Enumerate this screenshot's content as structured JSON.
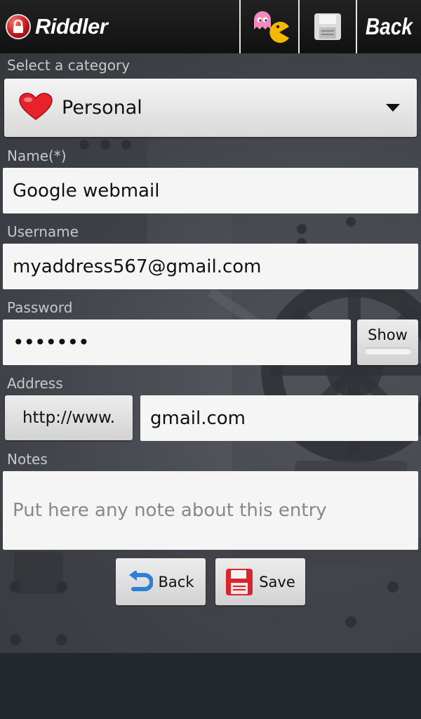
{
  "app": {
    "title": "Riddler",
    "toolbar": {
      "game_icon": "pacman-ghost-icon",
      "save_icon": "floppy-disk-icon",
      "back_label": "Back"
    }
  },
  "form": {
    "category": {
      "label": "Select a category",
      "selected": "Personal",
      "icon": "heart-icon",
      "icon_color": "#e8222b"
    },
    "name": {
      "label": "Name(*)",
      "value": "Google webmail"
    },
    "username": {
      "label": "Username",
      "value": "myaddress567@gmail.com"
    },
    "password": {
      "label": "Password",
      "value": "•••••••",
      "show_label": "Show"
    },
    "address": {
      "label": "Address",
      "prefix": "http://www.",
      "value": "gmail.com"
    },
    "notes": {
      "label": "Notes",
      "placeholder": "Put here any note about this entry"
    },
    "actions": {
      "back_label": "Back",
      "save_label": "Save"
    }
  },
  "colors": {
    "topbar": "#161616",
    "accent_blue": "#2f7fd6",
    "save_red": "#d9262e"
  }
}
